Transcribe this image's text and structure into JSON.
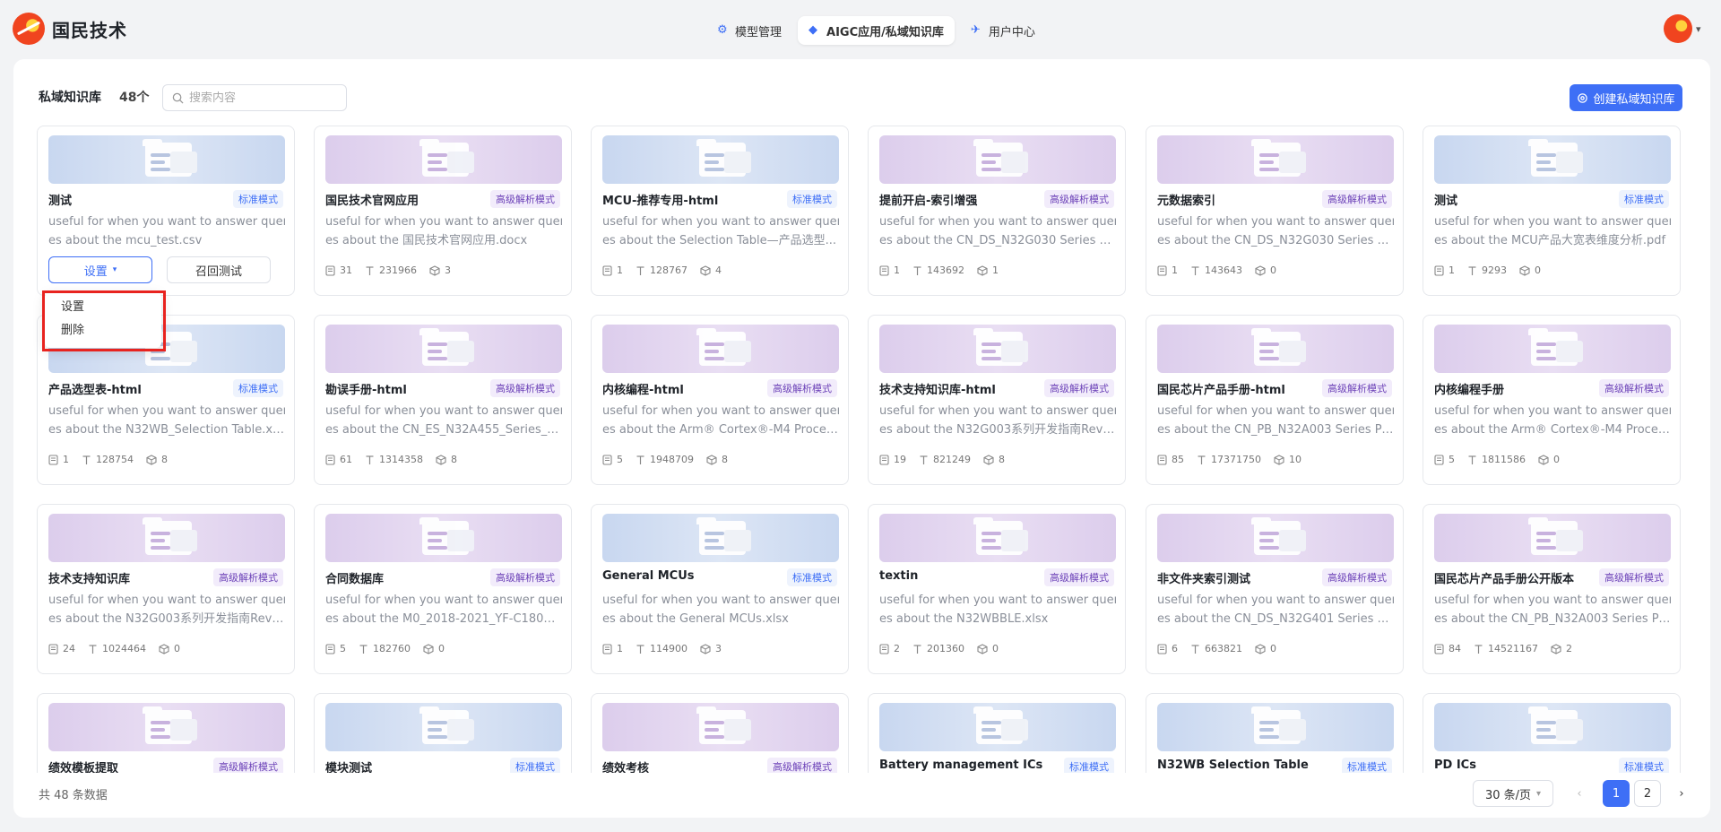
{
  "header": {
    "logo_text": "国民技术",
    "tabs": [
      {
        "label": "模型管理",
        "icon": "model-icon",
        "active": false
      },
      {
        "label": "AIGC应用/私域知识库",
        "icon": "aigc-icon",
        "active": true
      },
      {
        "label": "用户中心",
        "icon": "user-center-icon",
        "active": false
      }
    ]
  },
  "toolbar": {
    "title": "私域知识库",
    "count": "48个",
    "search_placeholder": "搜索内容",
    "create_label": "创建私域知识库"
  },
  "colors": {
    "accent": "#3e6ff6",
    "highlight_box": "#e8231f"
  },
  "cards": [
    {
      "title": "测试",
      "mode": "标准模式",
      "mode_type": "std",
      "desc1": "useful for when you want to answer queri",
      "desc2": "es about the mcu_test.csv",
      "docs": "",
      "chars": "",
      "items": "",
      "hovered": true
    },
    {
      "title": "国民技术官网应用",
      "mode": "高级解析模式",
      "mode_type": "adv",
      "desc1": "useful for when you want to answer queri",
      "desc2": "es about the 国民技术官网应用.docx",
      "docs": "31",
      "chars": "231966",
      "items": "3"
    },
    {
      "title": "MCU-推荐专用-html",
      "mode": "标准模式",
      "mode_type": "std",
      "desc1": "useful for when you want to answer queri",
      "desc2": "es about the Selection Table—产品选型...",
      "docs": "1",
      "chars": "128767",
      "items": "4"
    },
    {
      "title": "提前开启-索引增强",
      "mode": "高级解析模式",
      "mode_type": "adv",
      "desc1": "useful for when you want to answer queri",
      "desc2": "es about the CN_DS_N32G030 Series D...",
      "docs": "1",
      "chars": "143692",
      "items": "1"
    },
    {
      "title": "元数据索引",
      "mode": "高级解析模式",
      "mode_type": "adv",
      "desc1": "useful for when you want to answer queri",
      "desc2": "es about the CN_DS_N32G030 Series D...",
      "docs": "1",
      "chars": "143643",
      "items": "0"
    },
    {
      "title": "测试",
      "mode": "标准模式",
      "mode_type": "std",
      "desc1": "useful for when you want to answer queri",
      "desc2": "es about the MCU产品大宽表维度分析.pdf",
      "docs": "1",
      "chars": "9293",
      "items": "0"
    },
    {
      "title": "产品选型表-html",
      "mode": "标准模式",
      "mode_type": "std",
      "desc1": "useful for when you want to answer queri",
      "desc2": "es about the N32WB_Selection Table.xlsx",
      "docs": "1",
      "chars": "128754",
      "items": "8"
    },
    {
      "title": "勘误手册-html",
      "mode": "高级解析模式",
      "mode_type": "adv",
      "desc1": "useful for when you want to answer queri",
      "desc2": "es about the CN_ES_N32A455_Series_Er...",
      "docs": "61",
      "chars": "1314358",
      "items": "8"
    },
    {
      "title": "内核编程-html",
      "mode": "高级解析模式",
      "mode_type": "adv",
      "desc1": "useful for when you want to answer queri",
      "desc2": "es about the Arm® Cortex®-M4 Proces...",
      "docs": "5",
      "chars": "1948709",
      "items": "8"
    },
    {
      "title": "技术支持知识库-html",
      "mode": "高级解析模式",
      "mode_type": "adv",
      "desc1": "useful for when you want to answer queri",
      "desc2": "es about the N32G003系列开发指南Rev1...",
      "docs": "19",
      "chars": "821249",
      "items": "8"
    },
    {
      "title": "国民芯片产品手册-html",
      "mode": "高级解析模式",
      "mode_type": "adv",
      "desc1": "useful for when you want to answer queri",
      "desc2": "es about the CN_PB_N32A003 Series Pr...",
      "docs": "85",
      "chars": "17371750",
      "items": "10"
    },
    {
      "title": "内核编程手册",
      "mode": "高级解析模式",
      "mode_type": "adv",
      "desc1": "useful for when you want to answer queri",
      "desc2": "es about the Arm® Cortex®-M4 Proces...",
      "docs": "5",
      "chars": "1811586",
      "items": "0"
    },
    {
      "title": "技术支持知识库",
      "mode": "高级解析模式",
      "mode_type": "adv",
      "desc1": "useful for when you want to answer queri",
      "desc2": "es about the N32G003系列开发指南Rev1...",
      "docs": "24",
      "chars": "1024464",
      "items": "0"
    },
    {
      "title": "合同数据库",
      "mode": "高级解析模式",
      "mode_type": "adv",
      "desc1": "useful for when you want to answer queri",
      "desc2": "es about the M0_2018-2021_YF-C18001...",
      "docs": "5",
      "chars": "182760",
      "items": "0"
    },
    {
      "title": "General MCUs",
      "mode": "标准模式",
      "mode_type": "std",
      "desc1": "useful for when you want to answer queri",
      "desc2": "es about the General MCUs.xlsx",
      "docs": "1",
      "chars": "114900",
      "items": "3"
    },
    {
      "title": "textin",
      "mode": "高级解析模式",
      "mode_type": "adv",
      "desc1": "useful for when you want to answer queri",
      "desc2": "es about the N32WBBLE.xlsx",
      "docs": "2",
      "chars": "201360",
      "items": "0"
    },
    {
      "title": "非文件夹索引测试",
      "mode": "高级解析模式",
      "mode_type": "adv",
      "desc1": "useful for when you want to answer queri",
      "desc2": "es about the CN_DS_N32G401 Series D...",
      "docs": "6",
      "chars": "663821",
      "items": "0"
    },
    {
      "title": "国民芯片产品手册公开版本",
      "mode": "高级解析模式",
      "mode_type": "adv",
      "desc1": "useful for when you want to answer queri",
      "desc2": "es about the CN_PB_N32A003 Series Pr...",
      "docs": "84",
      "chars": "14521167",
      "items": "2"
    },
    {
      "title": "绩效模板提取",
      "mode": "高级解析模式",
      "mode_type": "adv",
      "desc1": "",
      "desc2": "",
      "docs": "",
      "chars": "",
      "items": ""
    },
    {
      "title": "模块测试",
      "mode": "标准模式",
      "mode_type": "std",
      "desc1": "",
      "desc2": "",
      "docs": "",
      "chars": "",
      "items": ""
    },
    {
      "title": "绩效考核",
      "mode": "高级解析模式",
      "mode_type": "adv",
      "desc1": "",
      "desc2": "",
      "docs": "",
      "chars": "",
      "items": ""
    },
    {
      "title": "Battery management ICs",
      "mode": "标准模式",
      "mode_type": "std",
      "desc1": "",
      "desc2": "",
      "docs": "",
      "chars": "",
      "items": ""
    },
    {
      "title": "N32WB Selection Table",
      "mode": "标准模式",
      "mode_type": "std",
      "desc1": "",
      "desc2": "",
      "docs": "",
      "chars": "",
      "items": ""
    },
    {
      "title": "PD ICs",
      "mode": "标准模式",
      "mode_type": "std",
      "desc1": "",
      "desc2": "",
      "docs": "",
      "chars": "",
      "items": ""
    }
  ],
  "card_actions": {
    "settings_label": "设置",
    "recall_label": "召回测试"
  },
  "dropdown": {
    "items": [
      "设置",
      "删除"
    ]
  },
  "footer": {
    "total": "共 48 条数据",
    "page_size": "30 条/页",
    "pages": [
      "1",
      "2"
    ],
    "current_page": "1"
  }
}
